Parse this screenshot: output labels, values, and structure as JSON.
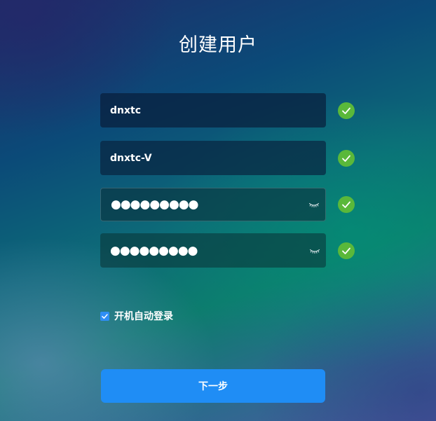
{
  "page": {
    "title": "创建用户"
  },
  "form": {
    "fields": [
      {
        "value": "dnxtc",
        "valid": true
      },
      {
        "value": "dnxtc-V",
        "valid": true
      },
      {
        "masked_value": "●●●●●●●●●",
        "valid": true,
        "icon": "eye-closed-icon"
      },
      {
        "masked_value": "●●●●●●●●●",
        "valid": true,
        "icon": "eye-closed-icon"
      }
    ],
    "auto_login": {
      "label": "开机自动登录",
      "checked": true
    },
    "next_button_label": "下一步"
  },
  "colors": {
    "valid_check": "#5ab83a",
    "accent": "#1f8df5",
    "checkbox": "#2f8ef4"
  }
}
